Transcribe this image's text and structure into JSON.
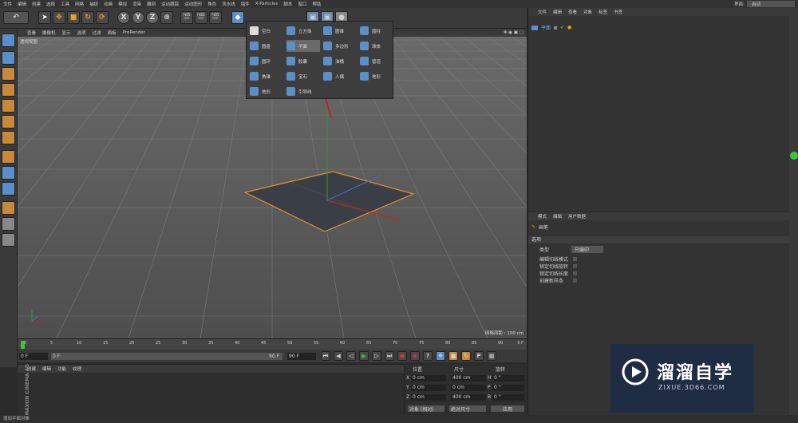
{
  "menubar": {
    "items": [
      "文件",
      "编辑",
      "创建",
      "选择",
      "工具",
      "网格",
      "捕捉",
      "动画",
      "模拟",
      "渲染",
      "雕刻",
      "运动跟踪",
      "运动图形",
      "角色",
      "流水线",
      "插件",
      "X-Particles",
      "脚本",
      "窗口",
      "帮助"
    ],
    "layout_label": "界面:",
    "layout_value": "启动"
  },
  "viewport_menu": [
    "查看",
    "摄像机",
    "显示",
    "选项",
    "过滤",
    "面板",
    "ProRender"
  ],
  "viewport": {
    "camera_label": "透视视图",
    "grid_spacing": "网格间距 : 100 cm"
  },
  "create_menu": {
    "col1": [
      "空白",
      "圆盘",
      "圆环",
      "角锥",
      "地形"
    ],
    "col2": [
      "立方体",
      "平面",
      "胶囊",
      "宝石",
      "引导线"
    ],
    "col3": [
      "圆锥",
      "多边形",
      "油桶",
      "人偶"
    ],
    "col4": [
      "圆柱",
      "球体",
      "管道",
      "地形"
    ],
    "highlighted": "平面"
  },
  "timeline": {
    "ticks": [
      "0",
      "5",
      "10",
      "15",
      "20",
      "25",
      "30",
      "35",
      "40",
      "45",
      "50",
      "55",
      "60",
      "65",
      "70",
      "75",
      "80",
      "85",
      "90"
    ],
    "end_label": "0 F"
  },
  "playbar": {
    "start": "0 F",
    "current": "0 F",
    "end": "90 F",
    "end2": "90 F"
  },
  "bottom_tabs": [
    "创建",
    "编辑",
    "功能",
    "纹理"
  ],
  "coords": {
    "headers": [
      "位置",
      "尺寸",
      "旋转"
    ],
    "rows": [
      {
        "axis": "X",
        "pos": "0 cm",
        "size": "400 cm",
        "rot_label": "H",
        "rot": "0 °"
      },
      {
        "axis": "Y",
        "pos": "0 cm",
        "size": "0 cm",
        "rot_label": "P",
        "rot": "0 °"
      },
      {
        "axis": "Z",
        "pos": "0 cm",
        "size": "400 cm",
        "rot_label": "B",
        "rot": "0 °"
      }
    ],
    "mode1": "对象 (相对)",
    "mode2": "绝对尺寸",
    "apply": "应用"
  },
  "object_manager": {
    "tabs": [
      "文件",
      "编辑",
      "查看",
      "对象",
      "标签",
      "书签"
    ],
    "object_name": "平面"
  },
  "attr_manager": {
    "tabs": [
      "模式",
      "编辑",
      "用户数据"
    ],
    "title": "画笔",
    "section": "选项",
    "type_label": "类型",
    "type_value": "只编印",
    "checks": [
      "编辑切线模式",
      "锁定切线旋转",
      "锁定切线长度",
      "创建新样条"
    ]
  },
  "status_text": "增加平面对象",
  "logo": {
    "text": "溜溜自学",
    "sub": "ZIXUE.3D66.COM"
  },
  "colors": {
    "accent": "#5b8fc9",
    "plane_edge": "#e5902a",
    "axis_red": "#d02020",
    "axis_green": "#2aa02a",
    "axis_blue": "#4a6ad0"
  }
}
